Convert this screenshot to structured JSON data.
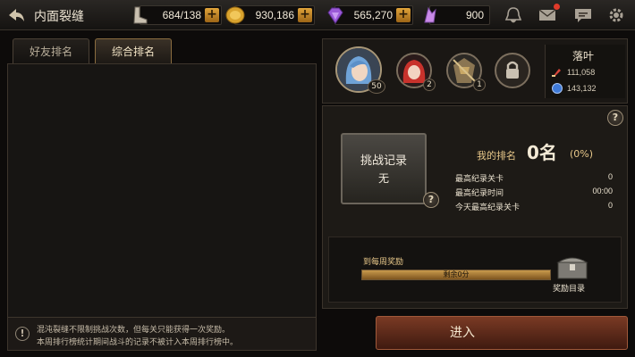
{
  "header": {
    "title": "内面裂缝",
    "resources": [
      {
        "name": "stamina",
        "value": "684/138",
        "icon": "boot-icon",
        "color": "#c9c0b0"
      },
      {
        "name": "gold",
        "value": "930,186",
        "icon": "gold-coin-icon",
        "color": "#e2b03c"
      },
      {
        "name": "gems",
        "value": "565,270",
        "icon": "purple-gem-icon",
        "color": "#9b5ad8"
      },
      {
        "name": "crystal",
        "value": "900",
        "icon": "crystal-icon",
        "color": "#c98ae8"
      }
    ],
    "icons": [
      "bell-icon",
      "mail-icon",
      "chat-icon",
      "settings-gear-icon"
    ]
  },
  "tabs": [
    {
      "label": "好友排名",
      "active": false
    },
    {
      "label": "综合排名",
      "active": true
    }
  ],
  "notice": {
    "icon": "exclamation-icon",
    "lines": [
      "混沌裂缝不限制挑战次数，但每关只能获得一次奖励。",
      "本周排行榜统计期间战斗的记录不被计入本周排行榜中。"
    ]
  },
  "team": {
    "heroes": [
      {
        "icon": "hero-portrait-blue-hair",
        "level": "50"
      },
      {
        "icon": "hero-portrait-red-hair",
        "level": "2"
      },
      {
        "icon": "hero-portrait-armored",
        "level": "1"
      },
      {
        "icon": "lock-icon",
        "level": ""
      }
    ],
    "player_name": "落叶",
    "stats": [
      {
        "icon": "sword-power-icon",
        "value": "111,058"
      },
      {
        "icon": "blue-orb-icon",
        "value": "143,132"
      }
    ]
  },
  "record": {
    "title": "挑战记录",
    "value": "无"
  },
  "ranking": {
    "label": "我的排名",
    "value": "0名",
    "percent": "(0%)",
    "rows": [
      {
        "label": "最高纪录关卡",
        "value": "0"
      },
      {
        "label": "最高纪录时间",
        "value": "00:00"
      },
      {
        "label": "今天最高纪录关卡",
        "value": "0"
      }
    ]
  },
  "reward": {
    "label": "到每周奖励",
    "remaining": "剩余0分",
    "progress": 1.0,
    "chest_label": "奖励目录"
  },
  "enter_button": {
    "label": "进入"
  }
}
